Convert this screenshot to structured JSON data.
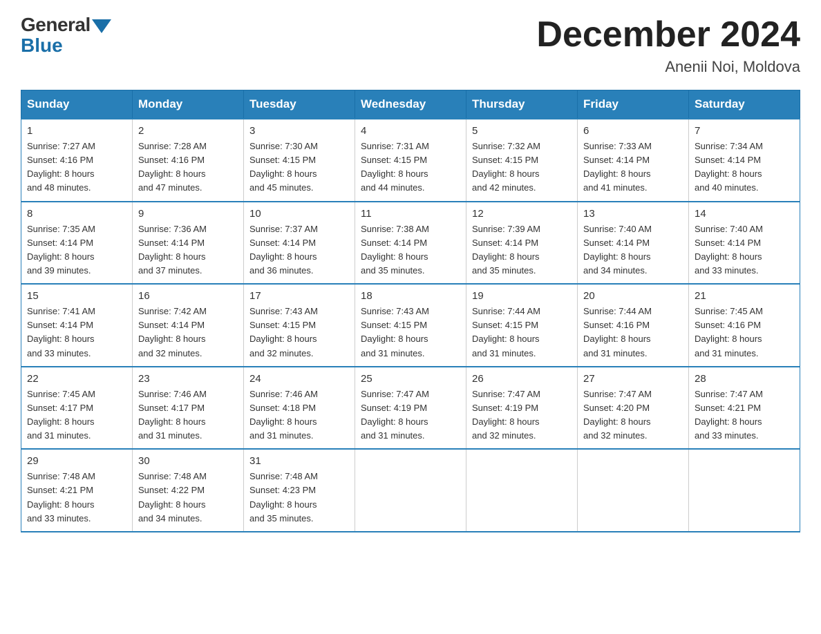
{
  "header": {
    "logo": {
      "general": "General",
      "blue": "Blue"
    },
    "title": "December 2024",
    "location": "Anenii Noi, Moldova"
  },
  "calendar": {
    "days_of_week": [
      "Sunday",
      "Monday",
      "Tuesday",
      "Wednesday",
      "Thursday",
      "Friday",
      "Saturday"
    ],
    "weeks": [
      [
        {
          "day": "1",
          "sunrise": "Sunrise: 7:27 AM",
          "sunset": "Sunset: 4:16 PM",
          "daylight": "Daylight: 8 hours",
          "daylight2": "and 48 minutes."
        },
        {
          "day": "2",
          "sunrise": "Sunrise: 7:28 AM",
          "sunset": "Sunset: 4:16 PM",
          "daylight": "Daylight: 8 hours",
          "daylight2": "and 47 minutes."
        },
        {
          "day": "3",
          "sunrise": "Sunrise: 7:30 AM",
          "sunset": "Sunset: 4:15 PM",
          "daylight": "Daylight: 8 hours",
          "daylight2": "and 45 minutes."
        },
        {
          "day": "4",
          "sunrise": "Sunrise: 7:31 AM",
          "sunset": "Sunset: 4:15 PM",
          "daylight": "Daylight: 8 hours",
          "daylight2": "and 44 minutes."
        },
        {
          "day": "5",
          "sunrise": "Sunrise: 7:32 AM",
          "sunset": "Sunset: 4:15 PM",
          "daylight": "Daylight: 8 hours",
          "daylight2": "and 42 minutes."
        },
        {
          "day": "6",
          "sunrise": "Sunrise: 7:33 AM",
          "sunset": "Sunset: 4:14 PM",
          "daylight": "Daylight: 8 hours",
          "daylight2": "and 41 minutes."
        },
        {
          "day": "7",
          "sunrise": "Sunrise: 7:34 AM",
          "sunset": "Sunset: 4:14 PM",
          "daylight": "Daylight: 8 hours",
          "daylight2": "and 40 minutes."
        }
      ],
      [
        {
          "day": "8",
          "sunrise": "Sunrise: 7:35 AM",
          "sunset": "Sunset: 4:14 PM",
          "daylight": "Daylight: 8 hours",
          "daylight2": "and 39 minutes."
        },
        {
          "day": "9",
          "sunrise": "Sunrise: 7:36 AM",
          "sunset": "Sunset: 4:14 PM",
          "daylight": "Daylight: 8 hours",
          "daylight2": "and 37 minutes."
        },
        {
          "day": "10",
          "sunrise": "Sunrise: 7:37 AM",
          "sunset": "Sunset: 4:14 PM",
          "daylight": "Daylight: 8 hours",
          "daylight2": "and 36 minutes."
        },
        {
          "day": "11",
          "sunrise": "Sunrise: 7:38 AM",
          "sunset": "Sunset: 4:14 PM",
          "daylight": "Daylight: 8 hours",
          "daylight2": "and 35 minutes."
        },
        {
          "day": "12",
          "sunrise": "Sunrise: 7:39 AM",
          "sunset": "Sunset: 4:14 PM",
          "daylight": "Daylight: 8 hours",
          "daylight2": "and 35 minutes."
        },
        {
          "day": "13",
          "sunrise": "Sunrise: 7:40 AM",
          "sunset": "Sunset: 4:14 PM",
          "daylight": "Daylight: 8 hours",
          "daylight2": "and 34 minutes."
        },
        {
          "day": "14",
          "sunrise": "Sunrise: 7:40 AM",
          "sunset": "Sunset: 4:14 PM",
          "daylight": "Daylight: 8 hours",
          "daylight2": "and 33 minutes."
        }
      ],
      [
        {
          "day": "15",
          "sunrise": "Sunrise: 7:41 AM",
          "sunset": "Sunset: 4:14 PM",
          "daylight": "Daylight: 8 hours",
          "daylight2": "and 33 minutes."
        },
        {
          "day": "16",
          "sunrise": "Sunrise: 7:42 AM",
          "sunset": "Sunset: 4:14 PM",
          "daylight": "Daylight: 8 hours",
          "daylight2": "and 32 minutes."
        },
        {
          "day": "17",
          "sunrise": "Sunrise: 7:43 AM",
          "sunset": "Sunset: 4:15 PM",
          "daylight": "Daylight: 8 hours",
          "daylight2": "and 32 minutes."
        },
        {
          "day": "18",
          "sunrise": "Sunrise: 7:43 AM",
          "sunset": "Sunset: 4:15 PM",
          "daylight": "Daylight: 8 hours",
          "daylight2": "and 31 minutes."
        },
        {
          "day": "19",
          "sunrise": "Sunrise: 7:44 AM",
          "sunset": "Sunset: 4:15 PM",
          "daylight": "Daylight: 8 hours",
          "daylight2": "and 31 minutes."
        },
        {
          "day": "20",
          "sunrise": "Sunrise: 7:44 AM",
          "sunset": "Sunset: 4:16 PM",
          "daylight": "Daylight: 8 hours",
          "daylight2": "and 31 minutes."
        },
        {
          "day": "21",
          "sunrise": "Sunrise: 7:45 AM",
          "sunset": "Sunset: 4:16 PM",
          "daylight": "Daylight: 8 hours",
          "daylight2": "and 31 minutes."
        }
      ],
      [
        {
          "day": "22",
          "sunrise": "Sunrise: 7:45 AM",
          "sunset": "Sunset: 4:17 PM",
          "daylight": "Daylight: 8 hours",
          "daylight2": "and 31 minutes."
        },
        {
          "day": "23",
          "sunrise": "Sunrise: 7:46 AM",
          "sunset": "Sunset: 4:17 PM",
          "daylight": "Daylight: 8 hours",
          "daylight2": "and 31 minutes."
        },
        {
          "day": "24",
          "sunrise": "Sunrise: 7:46 AM",
          "sunset": "Sunset: 4:18 PM",
          "daylight": "Daylight: 8 hours",
          "daylight2": "and 31 minutes."
        },
        {
          "day": "25",
          "sunrise": "Sunrise: 7:47 AM",
          "sunset": "Sunset: 4:19 PM",
          "daylight": "Daylight: 8 hours",
          "daylight2": "and 31 minutes."
        },
        {
          "day": "26",
          "sunrise": "Sunrise: 7:47 AM",
          "sunset": "Sunset: 4:19 PM",
          "daylight": "Daylight: 8 hours",
          "daylight2": "and 32 minutes."
        },
        {
          "day": "27",
          "sunrise": "Sunrise: 7:47 AM",
          "sunset": "Sunset: 4:20 PM",
          "daylight": "Daylight: 8 hours",
          "daylight2": "and 32 minutes."
        },
        {
          "day": "28",
          "sunrise": "Sunrise: 7:47 AM",
          "sunset": "Sunset: 4:21 PM",
          "daylight": "Daylight: 8 hours",
          "daylight2": "and 33 minutes."
        }
      ],
      [
        {
          "day": "29",
          "sunrise": "Sunrise: 7:48 AM",
          "sunset": "Sunset: 4:21 PM",
          "daylight": "Daylight: 8 hours",
          "daylight2": "and 33 minutes."
        },
        {
          "day": "30",
          "sunrise": "Sunrise: 7:48 AM",
          "sunset": "Sunset: 4:22 PM",
          "daylight": "Daylight: 8 hours",
          "daylight2": "and 34 minutes."
        },
        {
          "day": "31",
          "sunrise": "Sunrise: 7:48 AM",
          "sunset": "Sunset: 4:23 PM",
          "daylight": "Daylight: 8 hours",
          "daylight2": "and 35 minutes."
        },
        null,
        null,
        null,
        null
      ]
    ]
  }
}
